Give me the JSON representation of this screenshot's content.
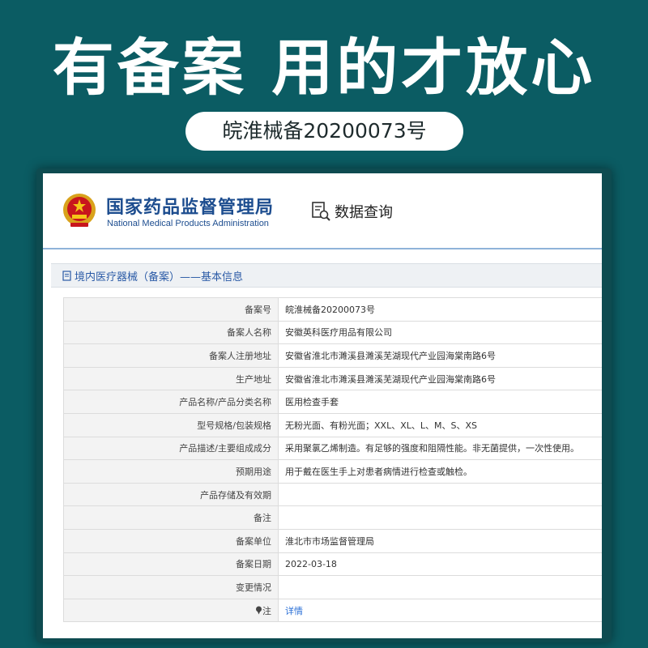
{
  "headline": "有备案 用的才放心",
  "registration_badge": "皖淮械备20200073号",
  "site": {
    "org_name_cn": "国家药品监督管理局",
    "org_name_en": "National Medical Products Administration",
    "query_label": "数据查询",
    "section_title": "境内医疗器械（备案）——基本信息"
  },
  "record": {
    "rows": [
      {
        "label": "备案号",
        "value": "皖淮械备20200073号"
      },
      {
        "label": "备案人名称",
        "value": "安徽英科医疗用品有限公司"
      },
      {
        "label": "备案人注册地址",
        "value": "安徽省淮北市濉溪县濉溪芜湖现代产业园海棠南路6号"
      },
      {
        "label": "生产地址",
        "value": "安徽省淮北市濉溪县濉溪芜湖现代产业园海棠南路6号"
      },
      {
        "label": "产品名称/产品分类名称",
        "value": "医用检查手套"
      },
      {
        "label": "型号规格/包装规格",
        "value": "无粉光面、有粉光面；XXL、XL、L、M、S、XS"
      },
      {
        "label": "产品描述/主要组成成分",
        "value": "采用聚氯乙烯制造。有足够的强度和阻隔性能。非无菌提供，一次性使用。"
      },
      {
        "label": "预期用途",
        "value": "用于戴在医生手上对患者病情进行检查或触检。"
      },
      {
        "label": "产品存储及有效期",
        "value": ""
      },
      {
        "label": "备注",
        "value": ""
      },
      {
        "label": "备案单位",
        "value": "淮北市市场监督管理局"
      },
      {
        "label": "备案日期",
        "value": "2022-03-18"
      },
      {
        "label": "变更情况",
        "value": ""
      }
    ],
    "note_label": "注",
    "note_link": "详情"
  },
  "colors": {
    "background": "#0b5c63",
    "brand_blue": "#1d4d8f",
    "link_blue": "#2a6fd6"
  },
  "icons": [
    "national-emblem-icon",
    "document-search-icon",
    "document-icon",
    "pin-icon"
  ]
}
